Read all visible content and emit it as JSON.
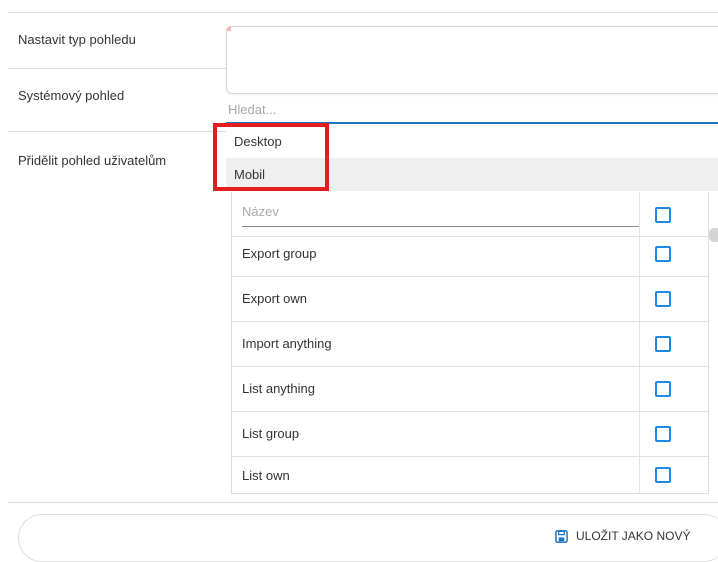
{
  "form": {
    "view_type_label": "Nastavit typ pohledu",
    "system_view_label": "Systémový pohled",
    "assign_label": "Přidělit pohled uživatelům"
  },
  "select": {
    "search_placeholder": "Hledat...",
    "options": [
      "Desktop",
      "Mobil"
    ]
  },
  "table": {
    "filter_placeholder": "Název",
    "rows": [
      "Export group",
      "Export own",
      "Import anything",
      "List anything",
      "List group",
      "List own"
    ]
  },
  "footer": {
    "save_as_new_label": "ULOŽIT JAKO NOVÝ",
    "save_icon": "floppy-disk-icon"
  },
  "colors": {
    "accent": "#1e73be",
    "checkbox": "#1e88e5",
    "highlight": "#e41e1e"
  }
}
